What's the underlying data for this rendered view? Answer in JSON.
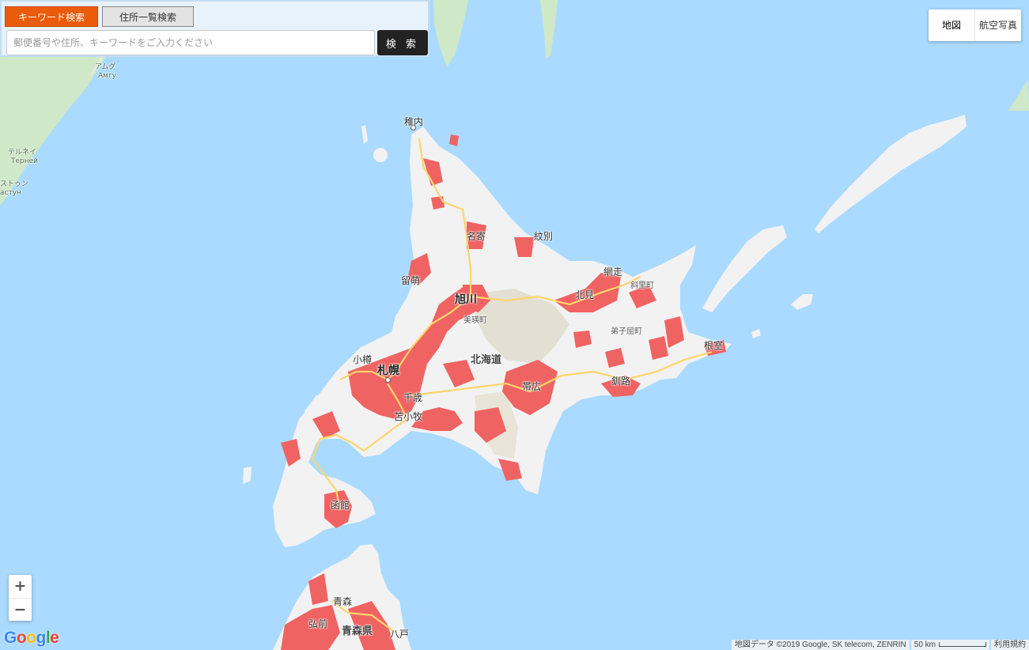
{
  "search": {
    "tab_keyword": "キーワード検索",
    "tab_address": "住所一覧検索",
    "placeholder": "郵便番号や住所、キーワードをご入力ください",
    "button": "検 索"
  },
  "map_type": {
    "map": "地図",
    "satellite": "航空写真"
  },
  "zoom": {
    "in": "+",
    "out": "−"
  },
  "labels": {
    "wakkanai": "稚内",
    "nayoro": "名寄",
    "monbetsu": "紋別",
    "rumoi": "留萌",
    "abashiri": "網走",
    "shari": "斜里町",
    "asahikawa": "旭川",
    "biei": "美瑛町",
    "kitami": "北見",
    "teshikaga": "弟子屈町",
    "nemuro": "根室",
    "otaru": "小樽",
    "hokkaido": "北海道",
    "sapporo": "札幌",
    "chitose": "千歳",
    "obihiro": "帯広",
    "kushiro": "釧路",
    "tomakomai": "苫小牧",
    "hakodate": "函館",
    "aomori": "青森",
    "hirosaki": "弘前",
    "aomori_pref": "青森県",
    "hachinohe": "八戸",
    "amgu_jp": "アムグ",
    "amgu_ru": "Амгу",
    "terney_jp": "テルネイ",
    "terney_ru": "Терней",
    "plastun_jp": "ストゥン",
    "plastun_ru": "астун"
  },
  "google_logo": "Google",
  "attribution": {
    "data": "地図データ ©2019 Google, SK telecom, ZENRIN",
    "scale": "50 km",
    "terms": "利用規約"
  },
  "colors": {
    "water": "#aadaff",
    "land": "#f2f2f2",
    "coverage": "#f06363",
    "road": "#fdd56b",
    "search_tab_active": "#ea5b0c"
  }
}
